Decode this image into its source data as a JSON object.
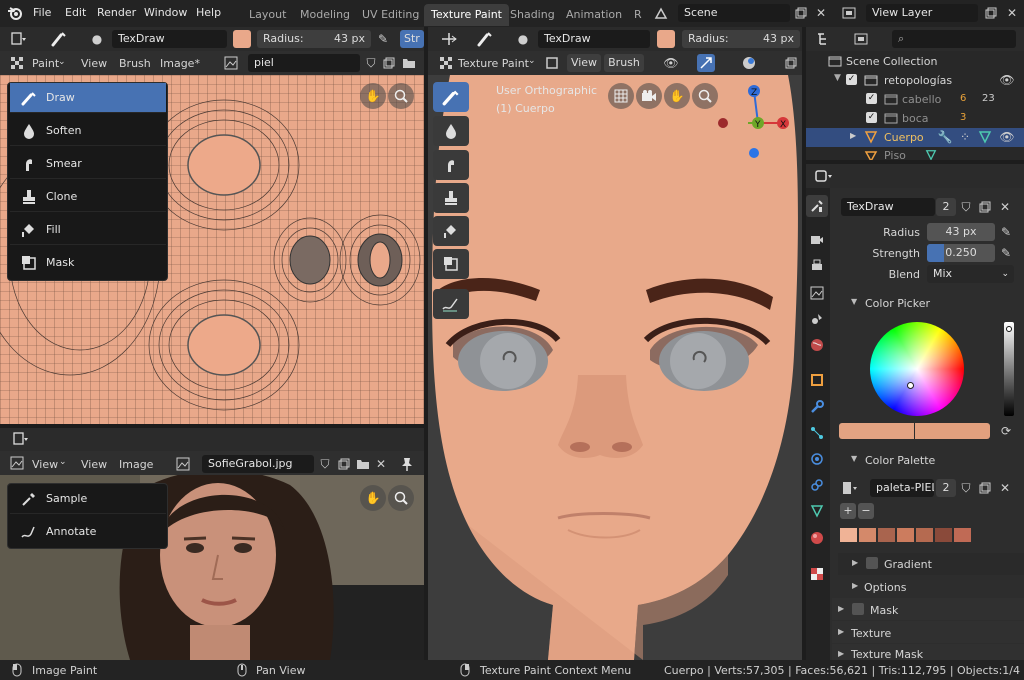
{
  "menus": [
    "File",
    "Edit",
    "Render",
    "Window",
    "Help"
  ],
  "workspaces": [
    "Layout",
    "Modeling",
    "UV Editing",
    "Texture Paint",
    "Shading",
    "Animation",
    "R"
  ],
  "active_workspace": "Texture Paint",
  "scene": "Scene",
  "view_layer": "View Layer",
  "uv_editor": {
    "brush": "TexDraw",
    "radius_label": "Radius:",
    "radius_value": "43 px",
    "str_label": "Str",
    "mode": "Paint",
    "menus": [
      "View",
      "Brush",
      "Image*"
    ],
    "image": "piel",
    "tools": [
      {
        "label": "Draw",
        "icon": "draw-brush-icon",
        "selected": true
      },
      {
        "label": "Soften",
        "icon": "soften-icon",
        "selected": false
      },
      {
        "label": "Smear",
        "icon": "smear-icon",
        "selected": false
      },
      {
        "label": "Clone",
        "icon": "clone-stamp-icon",
        "selected": false
      },
      {
        "label": "Fill",
        "icon": "fill-bucket-icon",
        "selected": false
      },
      {
        "label": "Mask",
        "icon": "mask-icon",
        "selected": false
      }
    ]
  },
  "image_editor": {
    "view_label": "View",
    "menus": [
      "View",
      "Image"
    ],
    "image": "SofieGrabol.jpg",
    "tools": [
      {
        "label": "Sample",
        "icon": "eyedropper-icon"
      },
      {
        "label": "Annotate",
        "icon": "annotate-icon"
      }
    ]
  },
  "viewport": {
    "brush": "TexDraw",
    "radius_label": "Radius:",
    "radius_value": "43 px",
    "mode": "Texture Paint",
    "menus": [
      "View",
      "Brush"
    ],
    "overlay_line1": "User Orthographic",
    "overlay_line2": "(1) Cuerpo",
    "gizmo_labels": [
      "Z",
      "Y",
      "X"
    ]
  },
  "outliner": {
    "root": "Scene Collection",
    "items": [
      {
        "label": "retopologías",
        "indent": 1,
        "kind": "collection"
      },
      {
        "label": "cabello",
        "indent": 2,
        "kind": "object",
        "badge1": "6",
        "badge2": "23"
      },
      {
        "label": "boca",
        "indent": 2,
        "kind": "object",
        "badge1": "3"
      },
      {
        "label": "Cuerpo",
        "indent": 2,
        "kind": "mesh",
        "selected": true
      },
      {
        "label": "Piso",
        "indent": 2,
        "kind": "mesh"
      }
    ]
  },
  "properties": {
    "brush": "TexDraw",
    "brush_users": "2",
    "radius_label": "Radius",
    "radius_value": "43 px",
    "strength_label": "Strength",
    "strength_value": "0.250",
    "strength_fraction": 0.25,
    "blend_label": "Blend",
    "blend_value": "Mix",
    "color_picker_label": "Color Picker",
    "color_palette_label": "Color Palette",
    "palette_name": "paleta-PIEL",
    "palette_users": "2",
    "palette_colors": [
      "#f0b396",
      "#d4896a",
      "#a9644e",
      "#cc7c5e",
      "#b56a50",
      "#8a4a3a",
      "#c06a55"
    ],
    "color_primary": "#e3a382",
    "color_secondary": "#e2a07e",
    "sections": [
      "Gradient",
      "Options",
      "Mask",
      "Texture",
      "Texture Mask"
    ]
  },
  "status": {
    "left": "Image Paint",
    "middle": "Pan View",
    "right_hint": "Texture Paint Context Menu",
    "stats": "Cuerpo | Verts:57,305 | Faces:56,621 | Tris:112,795 | Objects:1/4"
  },
  "colors": {
    "accent": "#4772b3",
    "skin": "#e9a88a",
    "header": "#2b2b2b"
  }
}
